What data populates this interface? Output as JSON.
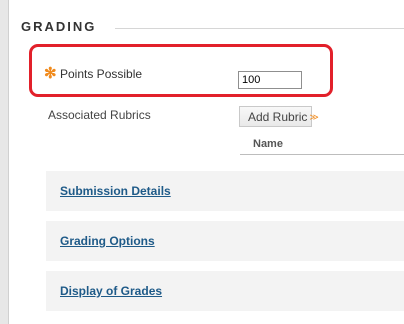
{
  "section": {
    "title": "GRADING"
  },
  "points_possible": {
    "required_marker": "✻",
    "label": "Points Possible",
    "value": "100"
  },
  "associated_rubrics": {
    "label": "Associated Rubrics",
    "add_button_label": "Add Rubric",
    "add_button_chevron": "≫",
    "table_column_name": "Name"
  },
  "collapsibles": [
    {
      "label": "Submission Details"
    },
    {
      "label": "Grading Options"
    },
    {
      "label": "Display of Grades"
    }
  ],
  "colors": {
    "highlight_border": "#e2202a",
    "required_marker": "#f08a1c",
    "link": "#1e5a88"
  }
}
